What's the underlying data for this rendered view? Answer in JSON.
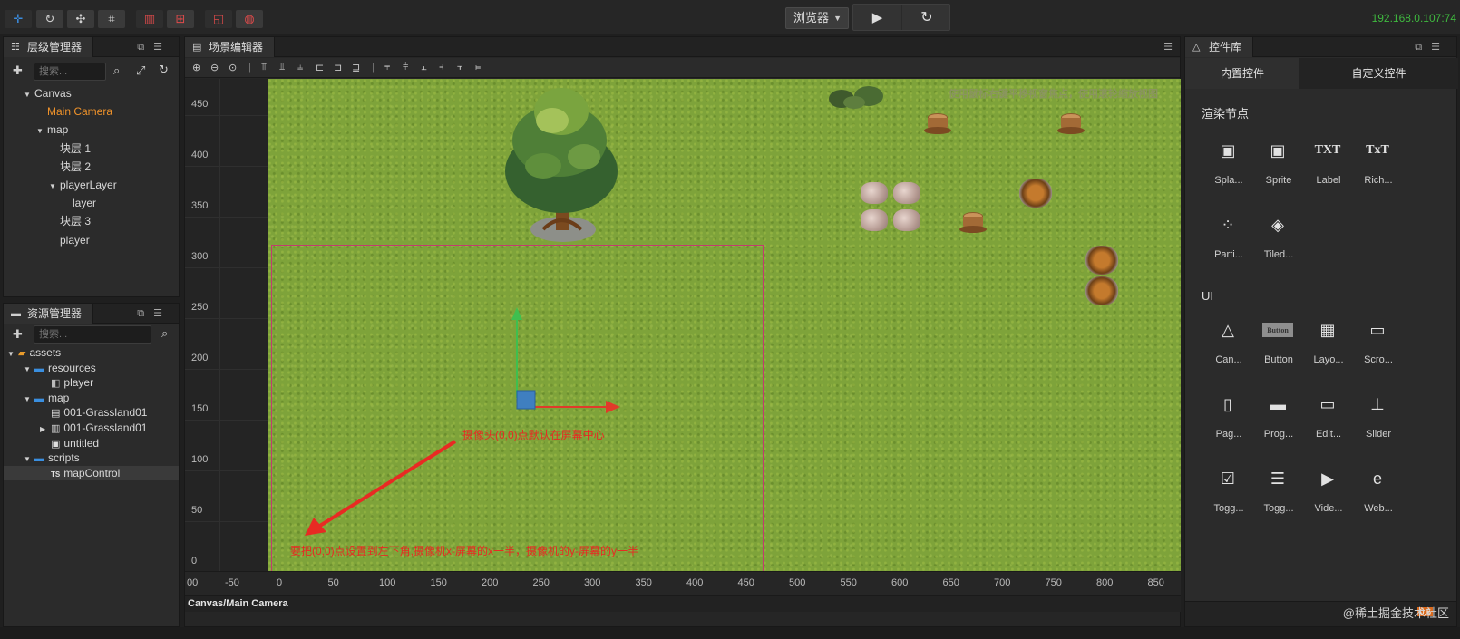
{
  "topbar": {
    "browser_select": "浏览器",
    "ip": "192.168.0.107:74"
  },
  "hierarchy": {
    "title": "层级管理器",
    "search_placeholder": "搜索...",
    "items": [
      {
        "label": "Canvas",
        "depth": 0,
        "expanded": true,
        "selected": false
      },
      {
        "label": "Main Camera",
        "depth": 1,
        "expanded": false,
        "selected": true
      },
      {
        "label": "map",
        "depth": 1,
        "expanded": true,
        "selected": false
      },
      {
        "label": "块层 1",
        "depth": 2,
        "expanded": false,
        "selected": false
      },
      {
        "label": "块层 2",
        "depth": 2,
        "expanded": false,
        "selected": false
      },
      {
        "label": "playerLayer",
        "depth": 2,
        "expanded": true,
        "selected": false
      },
      {
        "label": "layer",
        "depth": 3,
        "expanded": false,
        "selected": false
      },
      {
        "label": "块层 3",
        "depth": 2,
        "expanded": false,
        "selected": false
      },
      {
        "label": "player",
        "depth": 2,
        "expanded": false,
        "selected": false
      }
    ]
  },
  "assets": {
    "title": "资源管理器",
    "search_placeholder": "搜索...",
    "items": [
      {
        "label": "assets",
        "depth": 0,
        "icon": "assets-folder-icon"
      },
      {
        "label": "resources",
        "depth": 1,
        "icon": "folder-icon"
      },
      {
        "label": "player",
        "depth": 2,
        "icon": "prefab-icon"
      },
      {
        "label": "map",
        "depth": 1,
        "icon": "folder-icon"
      },
      {
        "label": "001-Grassland01",
        "depth": 2,
        "icon": "file-icon"
      },
      {
        "label": "001-Grassland01",
        "depth": 2,
        "icon": "tileset-icon"
      },
      {
        "label": "untitled",
        "depth": 2,
        "icon": "scene-icon"
      },
      {
        "label": "scripts",
        "depth": 1,
        "icon": "folder-icon"
      },
      {
        "label": "mapControl",
        "depth": 2,
        "icon": "typescript-icon"
      }
    ]
  },
  "scene": {
    "title": "场景编辑器",
    "hint": "使用鼠标右键平移视窗焦点，使用滚轮缩放视图",
    "status": "Canvas/Main Camera",
    "annotation_camera": "摄像头(0,0)点默认在屏幕中心",
    "annotation_bottom": "要把(0,0)点设置到左下角,摄像机x-屏幕的x一半，摄像机的y-屏幕的y一半",
    "y_ticks": [
      "450",
      "400",
      "350",
      "300",
      "250",
      "200",
      "150",
      "100",
      "50",
      "0"
    ],
    "x_ticks": [
      "00",
      "-50",
      "0",
      "50",
      "100",
      "150",
      "200",
      "250",
      "300",
      "350",
      "400",
      "450",
      "500",
      "550",
      "600",
      "650",
      "700",
      "750",
      "800",
      "850"
    ]
  },
  "library": {
    "title": "控件库",
    "tab_builtin": "内置控件",
    "tab_custom": "自定义控件",
    "section_render": "渲染节点",
    "section_ui": "UI",
    "render_items": [
      {
        "label": "Spla...",
        "glyph": "▣"
      },
      {
        "label": "Sprite",
        "glyph": "▣"
      },
      {
        "label": "Label",
        "glyph": "TXT"
      },
      {
        "label": "Rich...",
        "glyph": "TxT"
      },
      {
        "label": "Parti...",
        "glyph": "⁘"
      },
      {
        "label": "Tiled...",
        "glyph": "◈"
      }
    ],
    "ui_items": [
      {
        "label": "Can...",
        "glyph": "△"
      },
      {
        "label": "Button",
        "glyph": "Button"
      },
      {
        "label": "Layo...",
        "glyph": "▦"
      },
      {
        "label": "Scro...",
        "glyph": "▭"
      },
      {
        "label": "Pag...",
        "glyph": "▯"
      },
      {
        "label": "Prog...",
        "glyph": "▬"
      },
      {
        "label": "Edit...",
        "glyph": "▭"
      },
      {
        "label": "Slider",
        "glyph": "⊥"
      },
      {
        "label": "Togg...",
        "glyph": "☑"
      },
      {
        "label": "Togg...",
        "glyph": "☰"
      },
      {
        "label": "Vide...",
        "glyph": "▶"
      },
      {
        "label": "Web...",
        "glyph": "e"
      }
    ],
    "watermark": "@稀土掘金技术社区",
    "zoom": "0.6"
  },
  "colors": {
    "selected_text": "#f0932b",
    "annotation": "#e82a23",
    "camera_rect": "#c23b6f",
    "ip": "#3fb93f"
  }
}
